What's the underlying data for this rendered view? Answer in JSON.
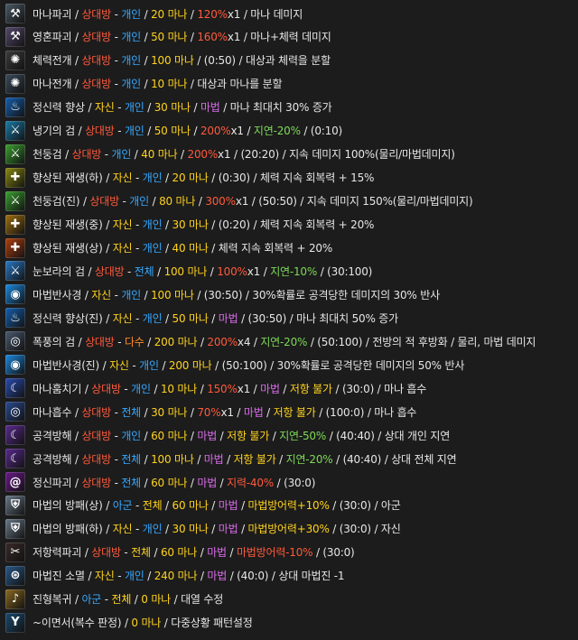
{
  "colors": {
    "w": "#e6e6e6",
    "r": "#ff5a3c",
    "b": "#36a8ff",
    "g": "#7ed957",
    "y": "#ffd21e",
    "m": "#d86be8",
    "o": "#ff8a2a"
  },
  "skills": [
    {
      "id": "mana-break",
      "icon": "axe-icon",
      "icon_bg": "#4a5a66",
      "icon_glyph": "⚒",
      "segs": [
        [
          "마나파괴",
          "w"
        ],
        [
          " / ",
          "w"
        ],
        [
          "상대방",
          "r"
        ],
        [
          " - ",
          "w"
        ],
        [
          "개인",
          "b"
        ],
        [
          " / ",
          "w"
        ],
        [
          "20 마나",
          "y"
        ],
        [
          " / ",
          "w"
        ],
        [
          "120%",
          "r"
        ],
        [
          "x1",
          "w"
        ],
        [
          " / 마나 데미지",
          "w"
        ]
      ]
    },
    {
      "id": "soul-break",
      "icon": "axe-icon",
      "icon_bg": "#564a6e",
      "icon_glyph": "⚒",
      "segs": [
        [
          "영혼파괴",
          "w"
        ],
        [
          " / ",
          "w"
        ],
        [
          "상대방",
          "r"
        ],
        [
          " - ",
          "w"
        ],
        [
          "개인",
          "b"
        ],
        [
          " / ",
          "w"
        ],
        [
          "50 마나",
          "y"
        ],
        [
          " / ",
          "w"
        ],
        [
          "160%",
          "r"
        ],
        [
          "x1",
          "w"
        ],
        [
          " / 마나+체력 데미지",
          "w"
        ]
      ]
    },
    {
      "id": "hp-split",
      "icon": "swirl-icon",
      "icon_bg": "#3c3c3c",
      "icon_glyph": "✺",
      "segs": [
        [
          "체력전개",
          "w"
        ],
        [
          " / ",
          "w"
        ],
        [
          "상대방",
          "r"
        ],
        [
          " - ",
          "w"
        ],
        [
          "개인",
          "b"
        ],
        [
          " / ",
          "w"
        ],
        [
          "100 마나",
          "y"
        ],
        [
          " / (0:50) / 대상과 체력을 분할",
          "w"
        ]
      ]
    },
    {
      "id": "mp-split",
      "icon": "swirl-icon",
      "icon_bg": "#3a4a5a",
      "icon_glyph": "✺",
      "segs": [
        [
          "마나전개",
          "w"
        ],
        [
          " / ",
          "w"
        ],
        [
          "상대방",
          "r"
        ],
        [
          " - ",
          "w"
        ],
        [
          "개인",
          "b"
        ],
        [
          " / ",
          "w"
        ],
        [
          "10 마나",
          "y"
        ],
        [
          " / 대상과 마나를 분할",
          "w"
        ]
      ]
    },
    {
      "id": "spirit-up",
      "icon": "flame-icon",
      "icon_bg": "#1560b0",
      "icon_glyph": "♨",
      "segs": [
        [
          "정신력 향상",
          "w"
        ],
        [
          " / ",
          "w"
        ],
        [
          "자신",
          "y"
        ],
        [
          " - ",
          "w"
        ],
        [
          "개인",
          "b"
        ],
        [
          " / ",
          "w"
        ],
        [
          "30 마나",
          "y"
        ],
        [
          " / ",
          "w"
        ],
        [
          "마법",
          "m"
        ],
        [
          " / 마나 최대치 30% 증가",
          "w"
        ]
      ]
    },
    {
      "id": "cold-sword",
      "icon": "sword-icon",
      "icon_bg": "#1a7ca8",
      "icon_glyph": "⚔",
      "segs": [
        [
          "냉기의 검",
          "w"
        ],
        [
          " / ",
          "w"
        ],
        [
          "상대방",
          "r"
        ],
        [
          " - ",
          "w"
        ],
        [
          "개인",
          "b"
        ],
        [
          " / ",
          "w"
        ],
        [
          "50 마나",
          "y"
        ],
        [
          " / ",
          "w"
        ],
        [
          "200%",
          "r"
        ],
        [
          "x1",
          "w"
        ],
        [
          " / ",
          "w"
        ],
        [
          "지연-20%",
          "g"
        ],
        [
          " / (0:10)",
          "w"
        ]
      ]
    },
    {
      "id": "thunder-sword",
      "icon": "sword-icon",
      "icon_bg": "#3aa030",
      "icon_glyph": "⚔",
      "segs": [
        [
          "천둥검",
          "w"
        ],
        [
          " / ",
          "w"
        ],
        [
          "상대방",
          "r"
        ],
        [
          " - ",
          "w"
        ],
        [
          "개인",
          "b"
        ],
        [
          " / ",
          "w"
        ],
        [
          "40 마나",
          "y"
        ],
        [
          " / ",
          "w"
        ],
        [
          "200%",
          "r"
        ],
        [
          "x1",
          "w"
        ],
        [
          " / (20:20) / 지속 데미지 100%(물리/마법데미지)",
          "w"
        ]
      ]
    },
    {
      "id": "regen-low",
      "icon": "cross-icon",
      "icon_bg": "#8a8a10",
      "icon_glyph": "✚",
      "segs": [
        [
          "향상된 재생(하)",
          "w"
        ],
        [
          " / ",
          "w"
        ],
        [
          "자신",
          "y"
        ],
        [
          " - ",
          "w"
        ],
        [
          "개인",
          "b"
        ],
        [
          " / ",
          "w"
        ],
        [
          "20 마나",
          "y"
        ],
        [
          " / (0:30) / 체력 지속 회복력 + 15%",
          "w"
        ]
      ]
    },
    {
      "id": "thunder-sword-true",
      "icon": "sword-icon",
      "icon_bg": "#3aa030",
      "icon_glyph": "⚔",
      "segs": [
        [
          "천둥검(진)",
          "w"
        ],
        [
          " / ",
          "w"
        ],
        [
          "상대방",
          "r"
        ],
        [
          " - ",
          "w"
        ],
        [
          "개인",
          "b"
        ],
        [
          " / ",
          "w"
        ],
        [
          "80 마나",
          "y"
        ],
        [
          " / ",
          "w"
        ],
        [
          "300%",
          "r"
        ],
        [
          "x1",
          "w"
        ],
        [
          " / (50:50) / 지속 데미지 150%(물리/마법데미지)",
          "w"
        ]
      ]
    },
    {
      "id": "regen-mid",
      "icon": "cross-icon",
      "icon_bg": "#a07010",
      "icon_glyph": "✚",
      "segs": [
        [
          "향상된 재생(중)",
          "w"
        ],
        [
          " / ",
          "w"
        ],
        [
          "자신",
          "y"
        ],
        [
          " - ",
          "w"
        ],
        [
          "개인",
          "b"
        ],
        [
          " / ",
          "w"
        ],
        [
          "30 마나",
          "y"
        ],
        [
          " / (0:20) / 체력 지속 회복력 + 20%",
          "w"
        ]
      ]
    },
    {
      "id": "regen-high",
      "icon": "cross-icon",
      "icon_bg": "#b04010",
      "icon_glyph": "✚",
      "segs": [
        [
          "향상된 재생(상)",
          "w"
        ],
        [
          " / ",
          "w"
        ],
        [
          "자신",
          "y"
        ],
        [
          " - ",
          "w"
        ],
        [
          "개인",
          "b"
        ],
        [
          " / ",
          "w"
        ],
        [
          "40 마나",
          "y"
        ],
        [
          " / 체력 지속 회복력 + 20%",
          "w"
        ]
      ]
    },
    {
      "id": "blizzard-sword",
      "icon": "sword-icon",
      "icon_bg": "#2a7ac8",
      "icon_glyph": "⚔",
      "segs": [
        [
          "눈보라의 검",
          "w"
        ],
        [
          " / ",
          "w"
        ],
        [
          "상대방",
          "r"
        ],
        [
          " - ",
          "w"
        ],
        [
          "전체",
          "b"
        ],
        [
          " / ",
          "w"
        ],
        [
          "100 마나",
          "y"
        ],
        [
          " / ",
          "w"
        ],
        [
          "100%",
          "r"
        ],
        [
          "x1",
          "w"
        ],
        [
          " / ",
          "w"
        ],
        [
          "지연-10%",
          "g"
        ],
        [
          " / (30:100)",
          "w"
        ]
      ]
    },
    {
      "id": "magic-reflect",
      "icon": "orb-icon",
      "icon_bg": "#1a8ae0",
      "icon_glyph": "◉",
      "segs": [
        [
          "마법반사경",
          "w"
        ],
        [
          " / ",
          "w"
        ],
        [
          "자신",
          "y"
        ],
        [
          " - ",
          "w"
        ],
        [
          "개인",
          "b"
        ],
        [
          " / ",
          "w"
        ],
        [
          "100 마나",
          "y"
        ],
        [
          " / (30:50) / 30%확률로 공격당한 데미지의 30% 반사",
          "w"
        ]
      ]
    },
    {
      "id": "spirit-up-true",
      "icon": "flame-icon",
      "icon_bg": "#1560b0",
      "icon_glyph": "♨",
      "segs": [
        [
          "정신력 향상(진)",
          "w"
        ],
        [
          " / ",
          "w"
        ],
        [
          "자신",
          "y"
        ],
        [
          " - ",
          "w"
        ],
        [
          "개인",
          "b"
        ],
        [
          " / ",
          "w"
        ],
        [
          "50 마나",
          "y"
        ],
        [
          " / ",
          "w"
        ],
        [
          "마법",
          "m"
        ],
        [
          " / (30:50) / 마나 최대치 50% 증가",
          "w"
        ]
      ]
    },
    {
      "id": "storm-sword",
      "icon": "vortex-icon",
      "icon_bg": "#4a5a70",
      "icon_glyph": "◎",
      "segs": [
        [
          "폭풍의 검",
          "w"
        ],
        [
          " / ",
          "w"
        ],
        [
          "상대방",
          "r"
        ],
        [
          " - ",
          "w"
        ],
        [
          "다수",
          "o"
        ],
        [
          " / ",
          "w"
        ],
        [
          "200 마나",
          "y"
        ],
        [
          " / ",
          "w"
        ],
        [
          "200%",
          "r"
        ],
        [
          "x4",
          "w"
        ],
        [
          " / ",
          "w"
        ],
        [
          "지연-20%",
          "g"
        ],
        [
          " / (50:100) / 전방의 적 후방화 / 물리, 마법 데미지",
          "w"
        ]
      ]
    },
    {
      "id": "magic-reflect-true",
      "icon": "orb-icon",
      "icon_bg": "#1a8ae0",
      "icon_glyph": "◉",
      "segs": [
        [
          "마법반사경(진)",
          "w"
        ],
        [
          " / ",
          "w"
        ],
        [
          "자신",
          "y"
        ],
        [
          " - ",
          "w"
        ],
        [
          "개인",
          "b"
        ],
        [
          " / ",
          "w"
        ],
        [
          "200 마나",
          "y"
        ],
        [
          " / (50:100) / 30%확률로 공격당한 데미지의 50% 반사",
          "w"
        ]
      ]
    },
    {
      "id": "mana-steal",
      "icon": "crescent-icon",
      "icon_bg": "#2a4ab0",
      "icon_glyph": "☾",
      "segs": [
        [
          "마나훔치기",
          "w"
        ],
        [
          " / ",
          "w"
        ],
        [
          "상대방",
          "r"
        ],
        [
          " - ",
          "w"
        ],
        [
          "개인",
          "b"
        ],
        [
          " / ",
          "w"
        ],
        [
          "10 마나",
          "y"
        ],
        [
          " / ",
          "w"
        ],
        [
          "150%",
          "r"
        ],
        [
          "x1",
          "w"
        ],
        [
          " / ",
          "w"
        ],
        [
          "마법",
          "m"
        ],
        [
          " / ",
          "w"
        ],
        [
          "저항 불가",
          "y"
        ],
        [
          " / (30:0) / 마나 흡수",
          "w"
        ]
      ]
    },
    {
      "id": "mana-absorb",
      "icon": "vortex-icon",
      "icon_bg": "#2a4a90",
      "icon_glyph": "◎",
      "segs": [
        [
          "마나흡수",
          "w"
        ],
        [
          " / ",
          "w"
        ],
        [
          "상대방",
          "r"
        ],
        [
          " - ",
          "w"
        ],
        [
          "전체",
          "b"
        ],
        [
          " / ",
          "w"
        ],
        [
          "30 마나",
          "y"
        ],
        [
          " / ",
          "w"
        ],
        [
          "70%",
          "r"
        ],
        [
          "x1",
          "w"
        ],
        [
          " / ",
          "w"
        ],
        [
          "마법",
          "m"
        ],
        [
          " / ",
          "w"
        ],
        [
          "저항 불가",
          "y"
        ],
        [
          " / (100:0) / 마나 흡수",
          "w"
        ]
      ]
    },
    {
      "id": "attack-block",
      "icon": "crescent-icon",
      "icon_bg": "#5a2a90",
      "icon_glyph": "☾",
      "segs": [
        [
          "공격방해",
          "w"
        ],
        [
          " / ",
          "w"
        ],
        [
          "상대방",
          "r"
        ],
        [
          " - ",
          "w"
        ],
        [
          "개인",
          "b"
        ],
        [
          " / ",
          "w"
        ],
        [
          "60 마나",
          "y"
        ],
        [
          " / ",
          "w"
        ],
        [
          "마법",
          "m"
        ],
        [
          " / ",
          "w"
        ],
        [
          "저항 불가",
          "y"
        ],
        [
          " / ",
          "w"
        ],
        [
          "지연-50%",
          "g"
        ],
        [
          " / (40:40) / 상대 개인 지연",
          "w"
        ]
      ]
    },
    {
      "id": "attack-block-all",
      "icon": "crescent-icon",
      "icon_bg": "#5a2a90",
      "icon_glyph": "☾",
      "segs": [
        [
          "공격방해",
          "w"
        ],
        [
          " / ",
          "w"
        ],
        [
          "상대방",
          "r"
        ],
        [
          " - ",
          "w"
        ],
        [
          "전체",
          "b"
        ],
        [
          " / ",
          "w"
        ],
        [
          "100 마나",
          "y"
        ],
        [
          " / ",
          "w"
        ],
        [
          "마법",
          "m"
        ],
        [
          " / ",
          "w"
        ],
        [
          "저항 불가",
          "y"
        ],
        [
          " / ",
          "w"
        ],
        [
          "지연-20%",
          "g"
        ],
        [
          " / (40:40) / 상대 전체 지연",
          "w"
        ]
      ]
    },
    {
      "id": "mind-break",
      "icon": "spiral-icon",
      "icon_bg": "#6a1a8a",
      "icon_glyph": "@",
      "segs": [
        [
          "정신파괴",
          "w"
        ],
        [
          " / ",
          "w"
        ],
        [
          "상대방",
          "r"
        ],
        [
          " - ",
          "w"
        ],
        [
          "전체",
          "b"
        ],
        [
          " / ",
          "w"
        ],
        [
          "60 마나",
          "y"
        ],
        [
          " / ",
          "w"
        ],
        [
          "마법",
          "m"
        ],
        [
          " / ",
          "w"
        ],
        [
          "지력-40%",
          "r"
        ],
        [
          " / (30:0)",
          "w"
        ]
      ]
    },
    {
      "id": "magic-shield-high",
      "icon": "shield-icon",
      "icon_bg": "#6a7a8a",
      "icon_glyph": "⛨",
      "segs": [
        [
          "마법의 방패(상)",
          "w"
        ],
        [
          " / ",
          "w"
        ],
        [
          "아군",
          "b"
        ],
        [
          " - ",
          "w"
        ],
        [
          "전체",
          "y"
        ],
        [
          " / ",
          "w"
        ],
        [
          "60 마나",
          "y"
        ],
        [
          " / ",
          "w"
        ],
        [
          "마법",
          "m"
        ],
        [
          " / ",
          "w"
        ],
        [
          "마법방어력+10%",
          "y"
        ],
        [
          " / (30:0) / 아군",
          "w"
        ]
      ]
    },
    {
      "id": "magic-shield-low",
      "icon": "shield-icon",
      "icon_bg": "#6a7a8a",
      "icon_glyph": "⛨",
      "segs": [
        [
          "마법의 방패(하)",
          "w"
        ],
        [
          " / ",
          "w"
        ],
        [
          "자신",
          "y"
        ],
        [
          " - ",
          "w"
        ],
        [
          "개인",
          "b"
        ],
        [
          " / ",
          "w"
        ],
        [
          "30 마나",
          "y"
        ],
        [
          " / ",
          "w"
        ],
        [
          "마법",
          "m"
        ],
        [
          " / ",
          "w"
        ],
        [
          "마법방어력+30%",
          "y"
        ],
        [
          " / (30:0) / 자신",
          "w"
        ]
      ]
    },
    {
      "id": "resist-break",
      "icon": "broken-sword-icon",
      "icon_bg": "#3a2a2a",
      "icon_glyph": "✂",
      "segs": [
        [
          "저항력파괴",
          "w"
        ],
        [
          " / ",
          "w"
        ],
        [
          "상대방",
          "r"
        ],
        [
          " - ",
          "w"
        ],
        [
          "전체",
          "y"
        ],
        [
          " / ",
          "w"
        ],
        [
          "60 마나",
          "y"
        ],
        [
          " / ",
          "w"
        ],
        [
          "마법",
          "m"
        ],
        [
          " / ",
          "w"
        ],
        [
          "마법방어력-10%",
          "r"
        ],
        [
          " / (30:0)",
          "w"
        ]
      ]
    },
    {
      "id": "circle-dispel",
      "icon": "rune-circle-icon",
      "icon_bg": "#2a5a8a",
      "icon_glyph": "⊛",
      "segs": [
        [
          "마법진 소멸",
          "w"
        ],
        [
          " / ",
          "w"
        ],
        [
          "자신",
          "y"
        ],
        [
          " - ",
          "w"
        ],
        [
          "개인",
          "b"
        ],
        [
          " / ",
          "w"
        ],
        [
          "240 마나",
          "y"
        ],
        [
          " / ",
          "w"
        ],
        [
          "마법",
          "m"
        ],
        [
          " / (40:0) / 상대 마법진 -1",
          "w"
        ]
      ]
    },
    {
      "id": "formation-recover",
      "icon": "horn-icon",
      "icon_bg": "#8a6a20",
      "icon_glyph": "♪",
      "segs": [
        [
          "진형복귀",
          "w"
        ],
        [
          " / ",
          "w"
        ],
        [
          "아군",
          "b"
        ],
        [
          " - ",
          "w"
        ],
        [
          "전체",
          "y"
        ],
        [
          " / ",
          "w"
        ],
        [
          "0 마나",
          "y"
        ],
        [
          " / 대열 수정",
          "w"
        ]
      ]
    },
    {
      "id": "while-doing",
      "icon": "fork-icon",
      "icon_bg": "#1a4a70",
      "icon_glyph": "Y",
      "segs": [
        [
          "~이면서(복수 판정)",
          "w"
        ],
        [
          " / ",
          "w"
        ],
        [
          "0 마나",
          "y"
        ],
        [
          " / 다중상황 패턴설정",
          "w"
        ]
      ]
    }
  ]
}
